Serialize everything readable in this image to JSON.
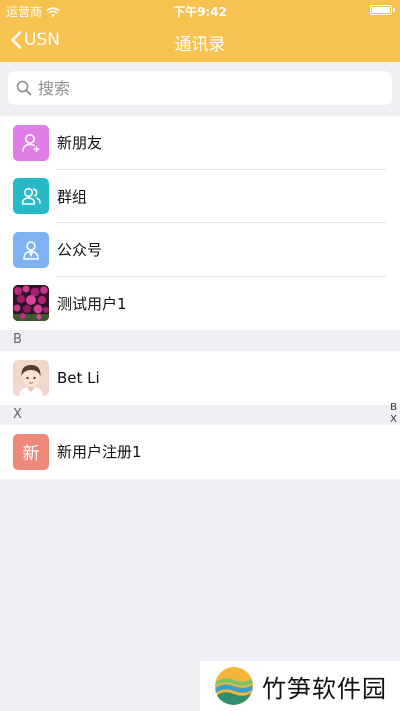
{
  "status_bar": {
    "carrier": "运营商",
    "time": "下午9:42"
  },
  "nav": {
    "back_label": "USN",
    "title": "通讯录"
  },
  "search": {
    "placeholder": "搜索"
  },
  "top_items": [
    {
      "label": "新朋友",
      "icon": "add-friend-icon",
      "color": "#e07de6"
    },
    {
      "label": "群组",
      "icon": "group-icon",
      "color": "#27b9c6"
    },
    {
      "label": "公众号",
      "icon": "official-account-icon",
      "color": "#7eb2f3"
    },
    {
      "label": "测试用户1",
      "icon": "flower-photo-avatar"
    }
  ],
  "sections": [
    {
      "letter": "B",
      "items": [
        {
          "label": "Bet Li",
          "icon": "cartoon-boy-avatar"
        }
      ]
    },
    {
      "letter": "X",
      "items": [
        {
          "label": "新用户注册1",
          "avatar_text": "新",
          "color": "#ef8a7b"
        }
      ]
    }
  ],
  "index_letters": [
    "B",
    "X"
  ],
  "watermark": {
    "text": "竹笋软件园"
  }
}
